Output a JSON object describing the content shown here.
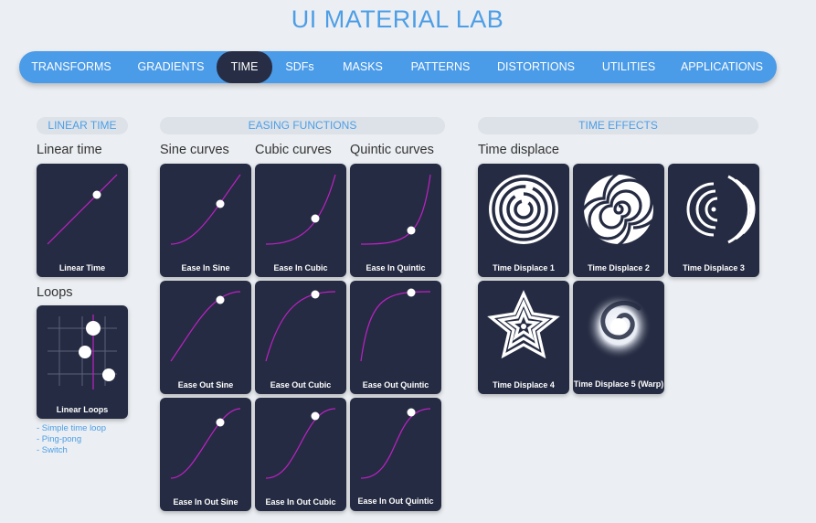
{
  "app": {
    "title": "UI MATERIAL LAB"
  },
  "nav": {
    "tabs": [
      {
        "label": "TRANSFORMS"
      },
      {
        "label": "GRADIENTS"
      },
      {
        "label": "TIME",
        "active": true
      },
      {
        "label": "SDFs"
      },
      {
        "label": "MASKS"
      },
      {
        "label": "PATTERNS"
      },
      {
        "label": "DISTORTIONS"
      },
      {
        "label": "UTILITIES"
      },
      {
        "label": "APPLICATIONS"
      }
    ]
  },
  "sections": {
    "linear_time": "LINEAR TIME",
    "easing_functions": "EASING FUNCTIONS",
    "time_effects": "TIME EFFECTS"
  },
  "headings": {
    "linear_time": "Linear time",
    "loops": "Loops",
    "sine": "Sine curves",
    "cubic": "Cubic curves",
    "quintic": "Quintic curves",
    "time_displace": "Time displace"
  },
  "cards": {
    "linear_time": "Linear Time",
    "linear_loops": "Linear Loops",
    "ease_in_sine": "Ease In Sine",
    "ease_in_cubic": "Ease In Cubic",
    "ease_in_quintic": "Ease In Quintic",
    "ease_out_sine": "Ease Out Sine",
    "ease_out_cubic": "Ease Out Cubic",
    "ease_out_quintic": "Ease Out Quintic",
    "ease_in_out_sine": "Ease In Out Sine",
    "ease_in_out_cubic": "Ease In Out Cubic",
    "ease_in_out_quintic": "Ease In Out Quintic",
    "time_displace_1": "Time Displace 1",
    "time_displace_2": "Time Displace 2",
    "time_displace_3": "Time Displace 3",
    "time_displace_4": "Time Displace 4",
    "time_displace_5": "Time Displace 5 (Warp)"
  },
  "loop_links": [
    "- Simple time loop",
    "- Ping-pong",
    "- Switch"
  ],
  "colors": {
    "accent": "#4a9be8",
    "active_tab": "#262d44",
    "card_bg": "#252b42",
    "curve": "#c020c8",
    "page_bg": "#ebeef2"
  },
  "icons": {
    "curve": "easing-curve-icon",
    "dot": "progress-dot-icon"
  }
}
